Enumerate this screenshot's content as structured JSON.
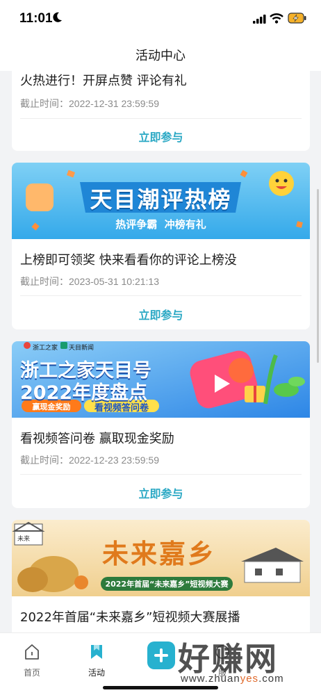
{
  "status_bar": {
    "time": "11:01"
  },
  "header": {
    "title": "活动中心"
  },
  "cards": [
    {
      "title": "火热进行！开屏点赞 评论有礼",
      "deadline": "截止时间：2022-12-31 23:59:59",
      "button": "立即参与"
    },
    {
      "banner": {
        "headline": "天目潮评热榜",
        "slogan": "热评争霸  冲榜有礼",
        "colors": [
          "#2ea6e8",
          "#7fd0f5"
        ]
      },
      "title": "上榜即可领奖 快来看看你的评论上榜没",
      "deadline": "截止时间：2023-05-31 10:21:13",
      "button": "立即参与"
    },
    {
      "banner": {
        "logo_left": "浙工之家",
        "logo_right": "天目新闻",
        "line1": "浙工之家天目号",
        "line2": "2022年度盘点",
        "tag1": "赢现金奖励",
        "tag2": "看视频答问卷",
        "colors": [
          "#2d86e6",
          "#8bcdf7"
        ]
      },
      "title": "看视频答问卷 赢取现金奖励",
      "deadline": "截止时间：2022-12-23 23:59:59",
      "button": "立即参与"
    },
    {
      "banner": {
        "corner": "未来",
        "headline": "未来嘉乡",
        "ribbon": "2022年首届“未来嘉乡”短视频大赛",
        "colors": [
          "#f3d9a8",
          "#fbeccd"
        ]
      },
      "title": "2022年首届“未来嘉乡”短视频大赛展播"
    }
  ],
  "tab_bar": {
    "tabs": [
      {
        "label": "首页",
        "icon": "home-icon"
      },
      {
        "label": "活动",
        "icon": "bookmark-icon",
        "active": true
      },
      {
        "label": "",
        "icon": "add-icon"
      },
      {
        "label": "服",
        "icon": "service-icon"
      }
    ]
  },
  "watermark": {
    "text": "好赚网",
    "url_prefix": "www.zhuan",
    "url_highlight": "yes",
    "url_suffix": ".com"
  },
  "accent_color": "#2aa8c4"
}
